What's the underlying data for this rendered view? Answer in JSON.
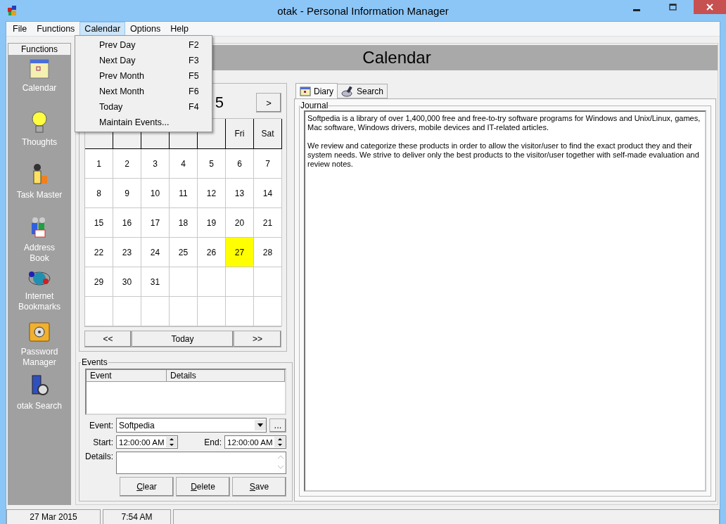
{
  "window": {
    "title": "otak - Personal Information Manager"
  },
  "menu_bar": [
    {
      "label": "File",
      "selected": false
    },
    {
      "label": "Functions",
      "selected": false
    },
    {
      "label": "Calendar",
      "selected": true
    },
    {
      "label": "Options",
      "selected": false
    },
    {
      "label": "Help",
      "selected": false
    }
  ],
  "open_menu": [
    {
      "label": "Prev Day",
      "shortcut": "F2"
    },
    {
      "label": "Next Day",
      "shortcut": "F3"
    },
    {
      "label": "Prev Month",
      "shortcut": "F5"
    },
    {
      "label": "Next Month",
      "shortcut": "F6"
    },
    {
      "label": "Today",
      "shortcut": "F4"
    },
    {
      "label": "Maintain Events..."
    }
  ],
  "sidebar": {
    "title": "Functions",
    "items": [
      {
        "label": "Calendar",
        "kind": "calendar"
      },
      {
        "label": "Thoughts",
        "kind": "bulb"
      },
      {
        "label": "Task Master",
        "kind": "worker"
      },
      {
        "label": "Address Book",
        "kind": "people"
      },
      {
        "label": "Internet Bookmarks",
        "kind": "globe"
      },
      {
        "label": "Password Manager",
        "kind": "safe"
      },
      {
        "label": "otak Search",
        "kind": "search"
      }
    ]
  },
  "header": {
    "title": "Calendar"
  },
  "calendar": {
    "month_title": "5",
    "next_button": ">",
    "weekdays": [
      "Fri",
      "Sat"
    ],
    "days": [
      {
        "day": "1",
        "selected": false
      },
      {
        "day": "2",
        "selected": false
      },
      {
        "day": "3",
        "selected": false
      },
      {
        "day": "4",
        "selected": false
      },
      {
        "day": "5",
        "selected": false
      },
      {
        "day": "6",
        "selected": false
      },
      {
        "day": "7",
        "selected": false
      },
      {
        "day": "8",
        "selected": false
      },
      {
        "day": "9",
        "selected": false
      },
      {
        "day": "10",
        "selected": false
      },
      {
        "day": "11",
        "selected": false
      },
      {
        "day": "12",
        "selected": false
      },
      {
        "day": "13",
        "selected": false
      },
      {
        "day": "14",
        "selected": false
      },
      {
        "day": "15",
        "selected": false
      },
      {
        "day": "16",
        "selected": false
      },
      {
        "day": "17",
        "selected": false
      },
      {
        "day": "18",
        "selected": false
      },
      {
        "day": "19",
        "selected": false
      },
      {
        "day": "20",
        "selected": false
      },
      {
        "day": "21",
        "selected": false
      },
      {
        "day": "22",
        "selected": false
      },
      {
        "day": "23",
        "selected": false
      },
      {
        "day": "24",
        "selected": false
      },
      {
        "day": "25",
        "selected": false
      },
      {
        "day": "26",
        "selected": false
      },
      {
        "day": "27",
        "selected": true
      },
      {
        "day": "28",
        "selected": false
      },
      {
        "day": "29",
        "selected": false
      },
      {
        "day": "30",
        "selected": false
      },
      {
        "day": "31",
        "selected": false
      }
    ],
    "nav": [
      "<<",
      "Today",
      ">>"
    ]
  },
  "events": {
    "title": "Events",
    "columns": [
      "Event",
      "Details"
    ],
    "event_label": "Event:",
    "event_value": "Softpedia",
    "more_button": "...",
    "start_label": "Start:",
    "start_value": "12:00:00 AM",
    "end_label": "End:",
    "end_value": "12:00:00 AM",
    "details_label": "Details:",
    "buttons": [
      "Clear",
      "Delete",
      "Save"
    ]
  },
  "tabs": [
    {
      "label": "Diary",
      "selected": true,
      "kind": "diary"
    },
    {
      "label": "Search",
      "selected": false,
      "kind": "search"
    }
  ],
  "journal": {
    "title": "Journal",
    "text": "Softpedia is a library of over 1,400,000 free and free-to-try software programs for Windows and Unix/Linux, games, Mac software, Windows drivers, mobile devices and IT-related articles.\n\nWe review and categorize these products in order to allow the visitor/user to find the exact product they and their system needs. We strive to deliver only the best products to the visitor/user together with self-made evaluation and review notes."
  },
  "status_bar": [
    "27 Mar 2015",
    "7:54 AM"
  ]
}
